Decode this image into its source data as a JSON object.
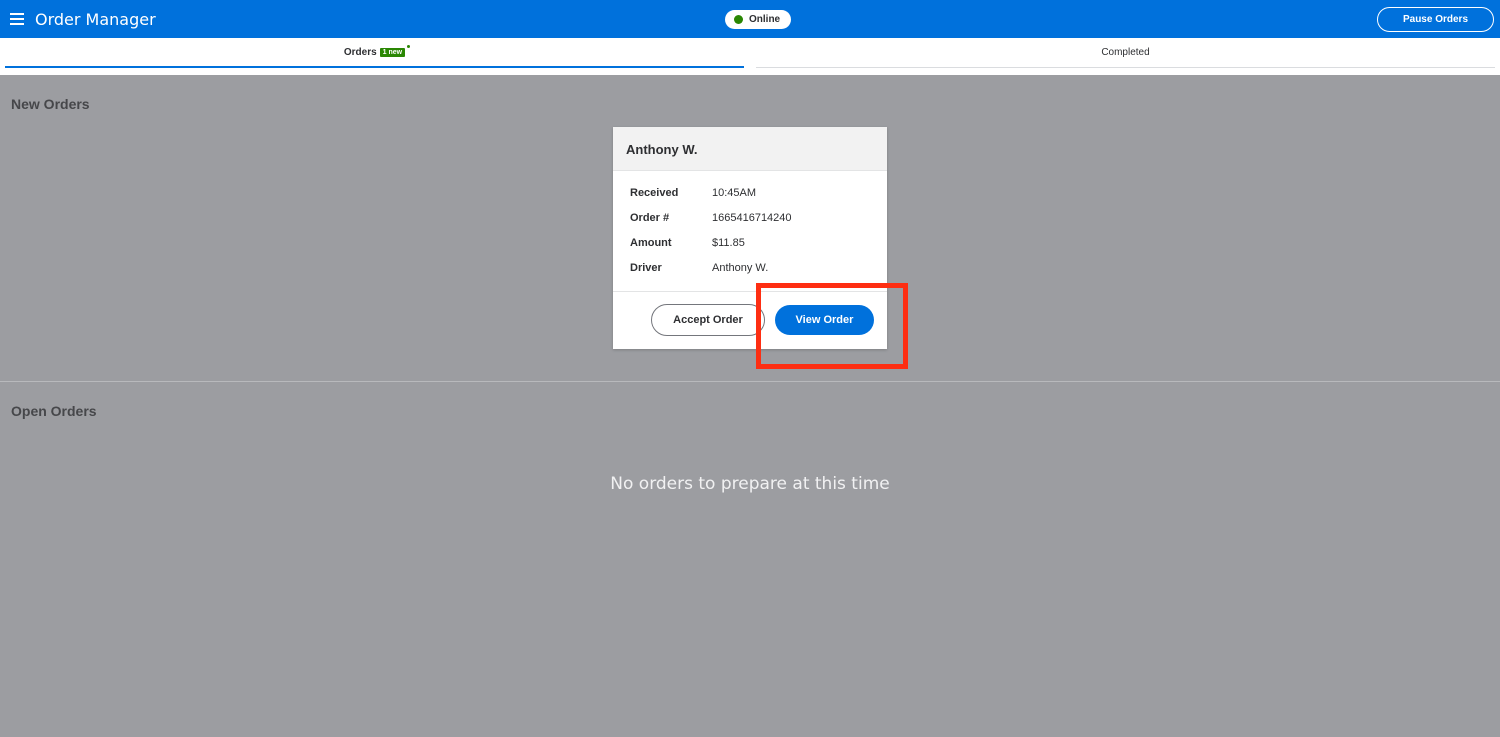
{
  "topbar": {
    "title": "Order Manager",
    "status": "Online",
    "pause_label": "Pause Orders"
  },
  "tabs": {
    "orders_label": "Orders",
    "orders_badge": "1 new",
    "completed_label": "Completed"
  },
  "new_orders": {
    "title": "New Orders",
    "card": {
      "customer": "Anthony W.",
      "rows": [
        {
          "label": "Received",
          "value": "10:45AM"
        },
        {
          "label": "Order #",
          "value": "1665416714240"
        },
        {
          "label": "Amount",
          "value": "$11.85"
        },
        {
          "label": "Driver",
          "value": "Anthony W."
        }
      ],
      "accept_label": "Accept Order",
      "view_label": "View Order"
    }
  },
  "open_orders": {
    "title": "Open Orders",
    "empty_message": "No orders to prepare at this time"
  },
  "colors": {
    "brand_blue": "#0071dc",
    "success_green": "#2a8703",
    "highlight_red": "#fe2e12"
  }
}
